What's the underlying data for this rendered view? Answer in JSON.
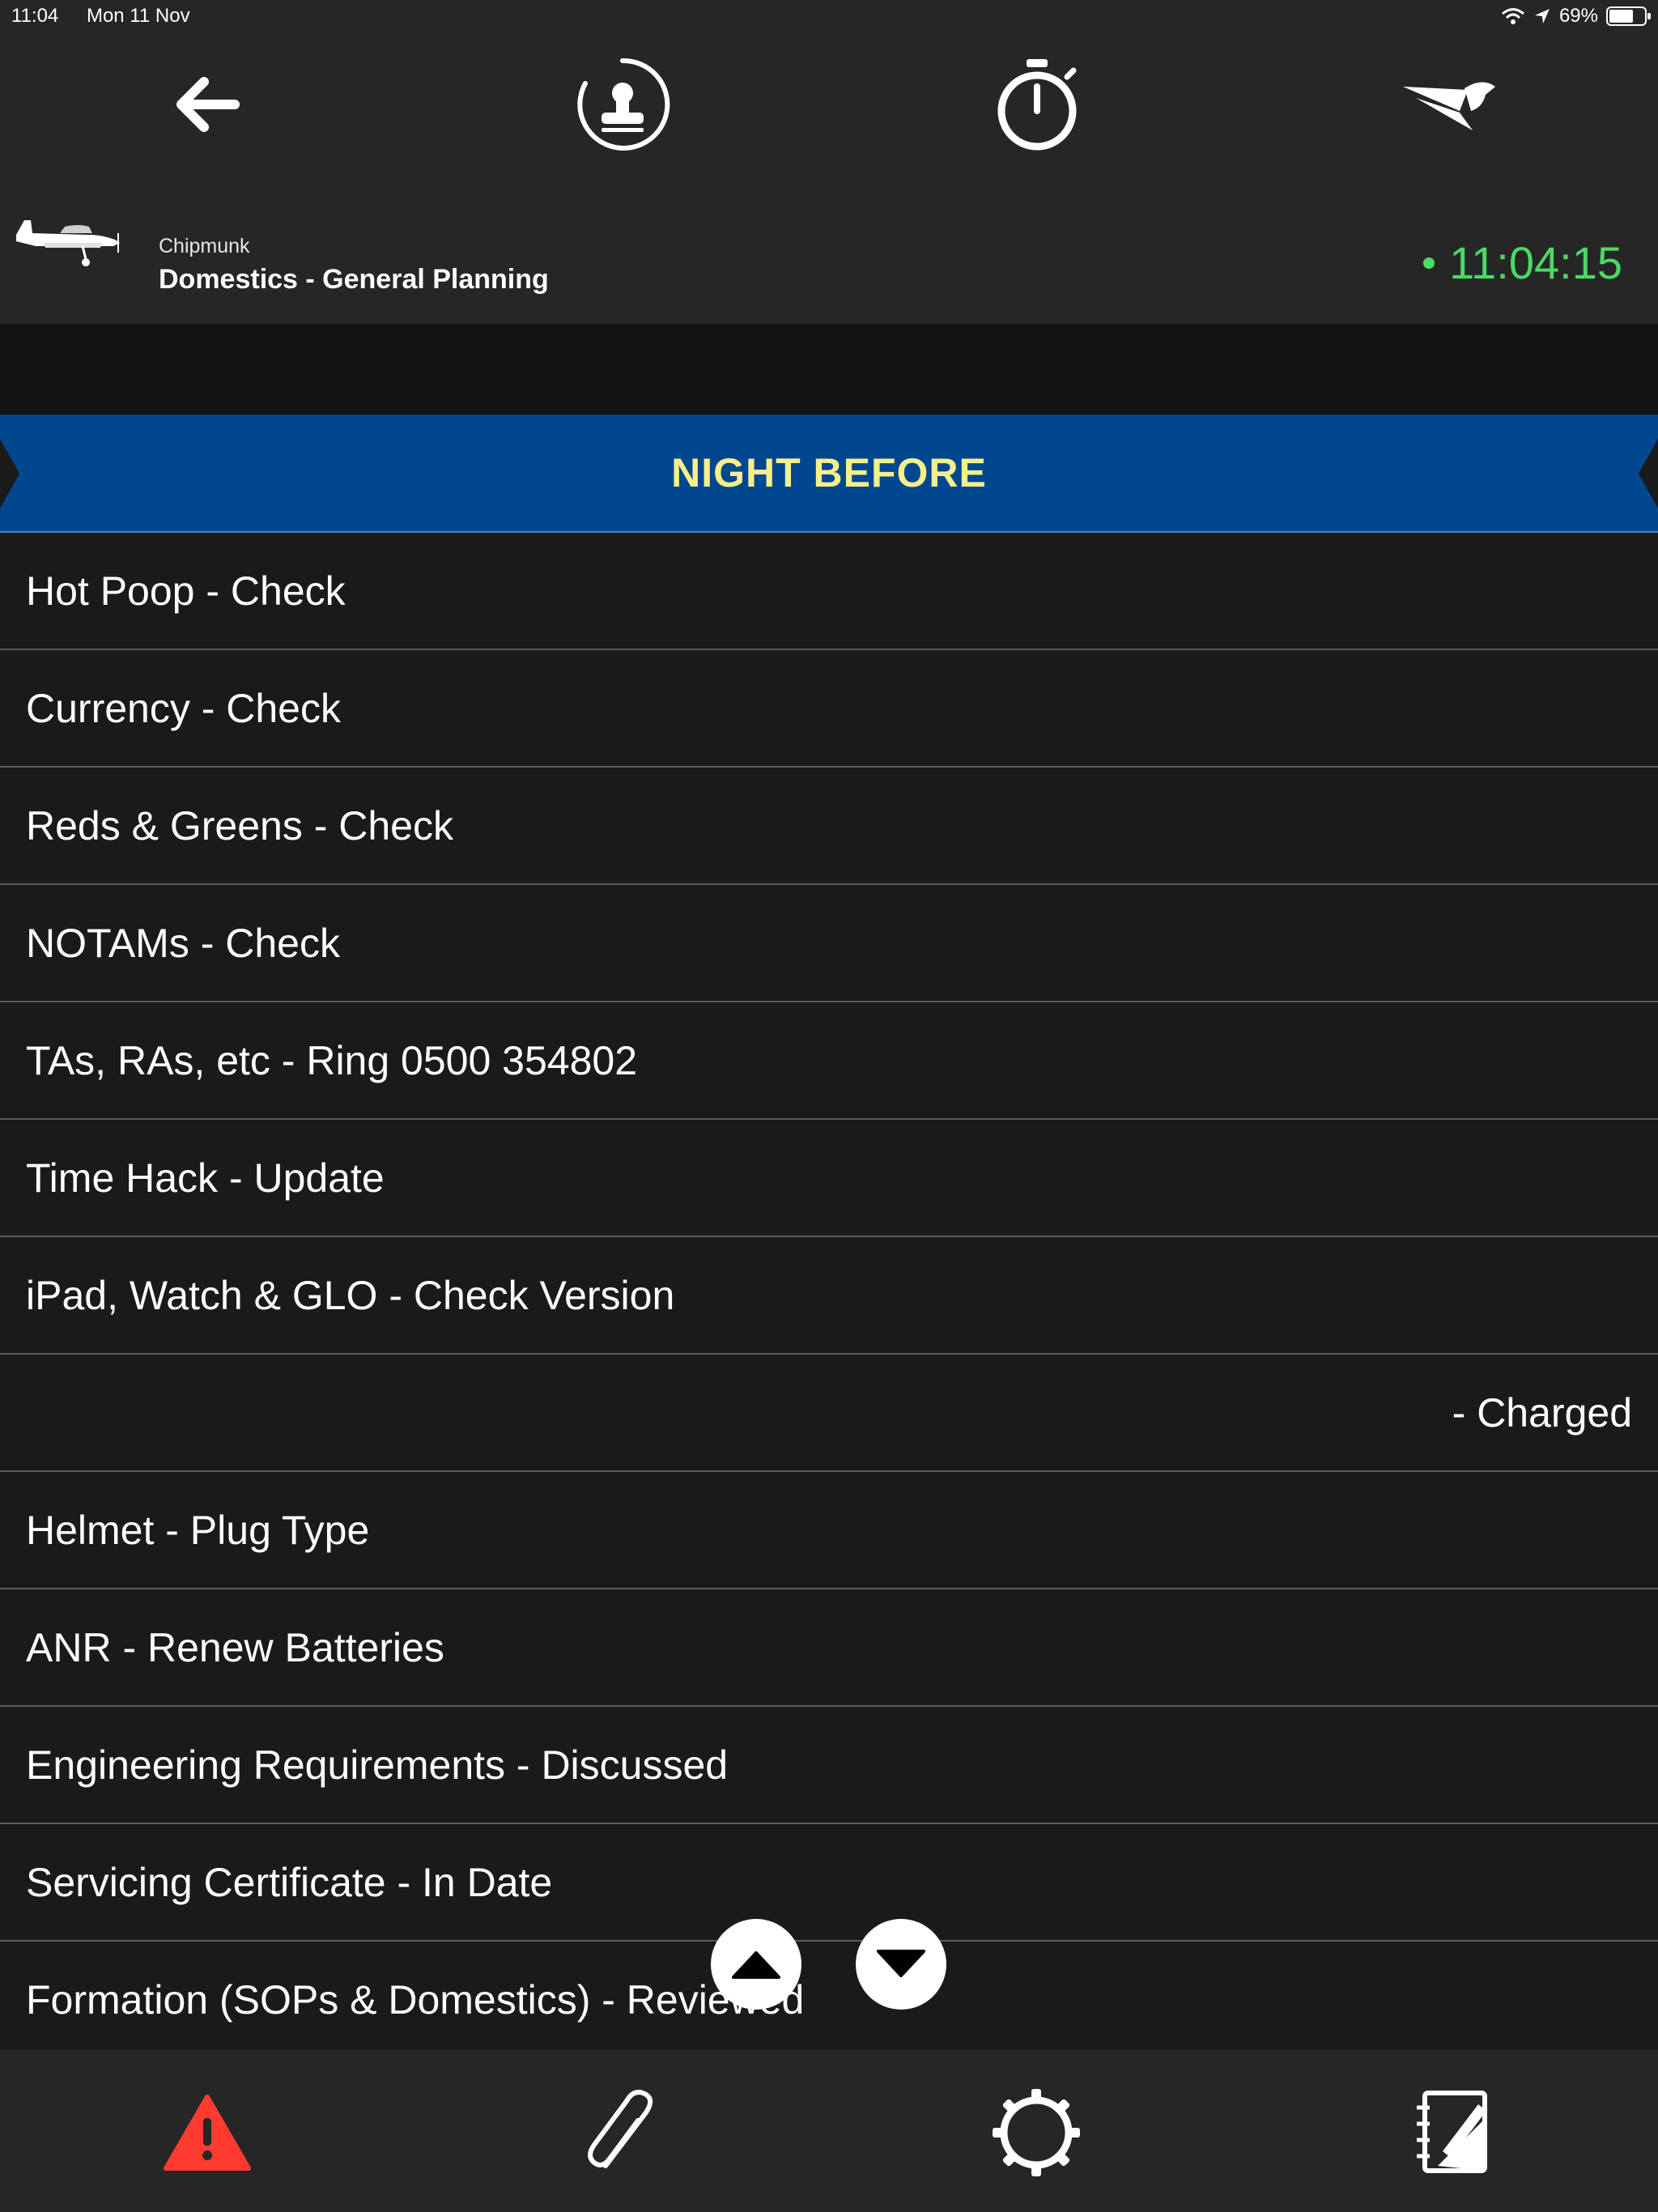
{
  "status_bar": {
    "time": "11:04",
    "date": "Mon 11 Nov",
    "battery": "69%",
    "battery_level": 0.69
  },
  "header": {
    "icons": [
      "back-arrow-icon",
      "stamp-icon",
      "stopwatch-icon",
      "logo-icon"
    ],
    "aircraft_type": "Chipmunk",
    "checklist_title": "Domestics - General Planning",
    "clock": "11:04:15",
    "clock_color": "#4cd964"
  },
  "section": {
    "title": "NIGHT BEFORE",
    "banner_color": "#00478f",
    "title_color": "#f5f08a"
  },
  "items": [
    "Hot Poop - Check",
    "Currency - Check",
    "Reds & Greens - Check",
    "NOTAMs - Check",
    "TAs, RAs, etc - Ring 0500 354802",
    "Time Hack - Update",
    "iPad, Watch & GLO - Check Version",
    "- Charged",
    "Helmet - Plug Type",
    "ANR - Renew Batteries",
    "Engineering Requirements - Discussed",
    "Servicing Certificate - In Date",
    "Formation (SOPs & Domestics) - Reviewed"
  ],
  "toolbar": {
    "icons": [
      "warning-icon",
      "paperclip-icon",
      "settings-icon",
      "notes-icon"
    ],
    "warning_color": "#ff3b30"
  }
}
